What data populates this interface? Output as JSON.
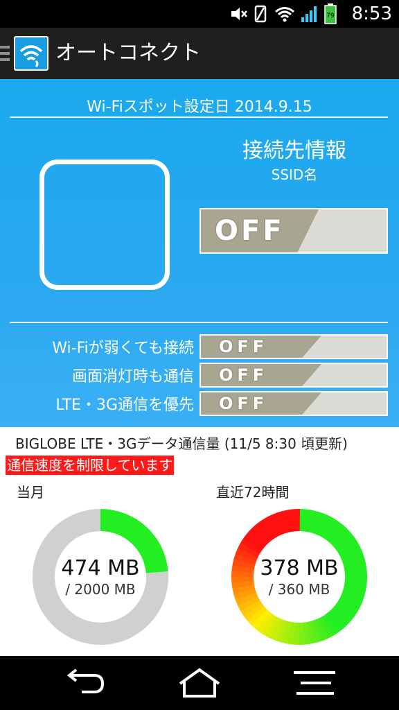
{
  "status_bar": {
    "time": "8:53",
    "battery_level": "79",
    "icons": [
      "mute-icon",
      "vibrate-icon",
      "wifi-icon",
      "signal-icon",
      "battery-icon"
    ]
  },
  "app_bar": {
    "title": "オートコネクト",
    "icon": "wifi-connect-app-icon"
  },
  "panel": {
    "setup_date": "Wi-Fiスポット設定日 2014.9.15",
    "connection_heading": "接続先情報",
    "ssid_label": "SSID名",
    "main_toggle": "OFF",
    "options": [
      {
        "label": "Wi-Fiが弱くても接続",
        "state": "OFF"
      },
      {
        "label": "画面消灯時も通信",
        "state": "OFF"
      },
      {
        "label": "LTE・3G通信を優先",
        "state": "OFF"
      }
    ],
    "colors": {
      "panel": "#1aa9ee",
      "toggle_knob": "#a8a690",
      "toggle_track": "#dcdcd6"
    }
  },
  "data_usage": {
    "title": "BIGLOBE LTE・3Gデータ通信量 (11/5 8:30 頃更新)",
    "limit_banner": "通信速度を制限しています",
    "monthly": {
      "label": "当月",
      "used": "474 MB",
      "cap": "/ 2000 MB",
      "fraction": 0.237
    },
    "recent": {
      "label": "直近72時間",
      "used": "378 MB",
      "cap": "/ 360 MB",
      "fraction": 1.0
    },
    "colors": {
      "ok": "#22ee22",
      "track": "#d0d0d0",
      "over_start": "#22ee22",
      "over_mid": "#ffee00",
      "over_end": "#ff1111",
      "banner": "#ff1a1a"
    }
  },
  "nav_bar": {
    "buttons": [
      "back-icon",
      "home-icon",
      "menu-icon"
    ]
  }
}
